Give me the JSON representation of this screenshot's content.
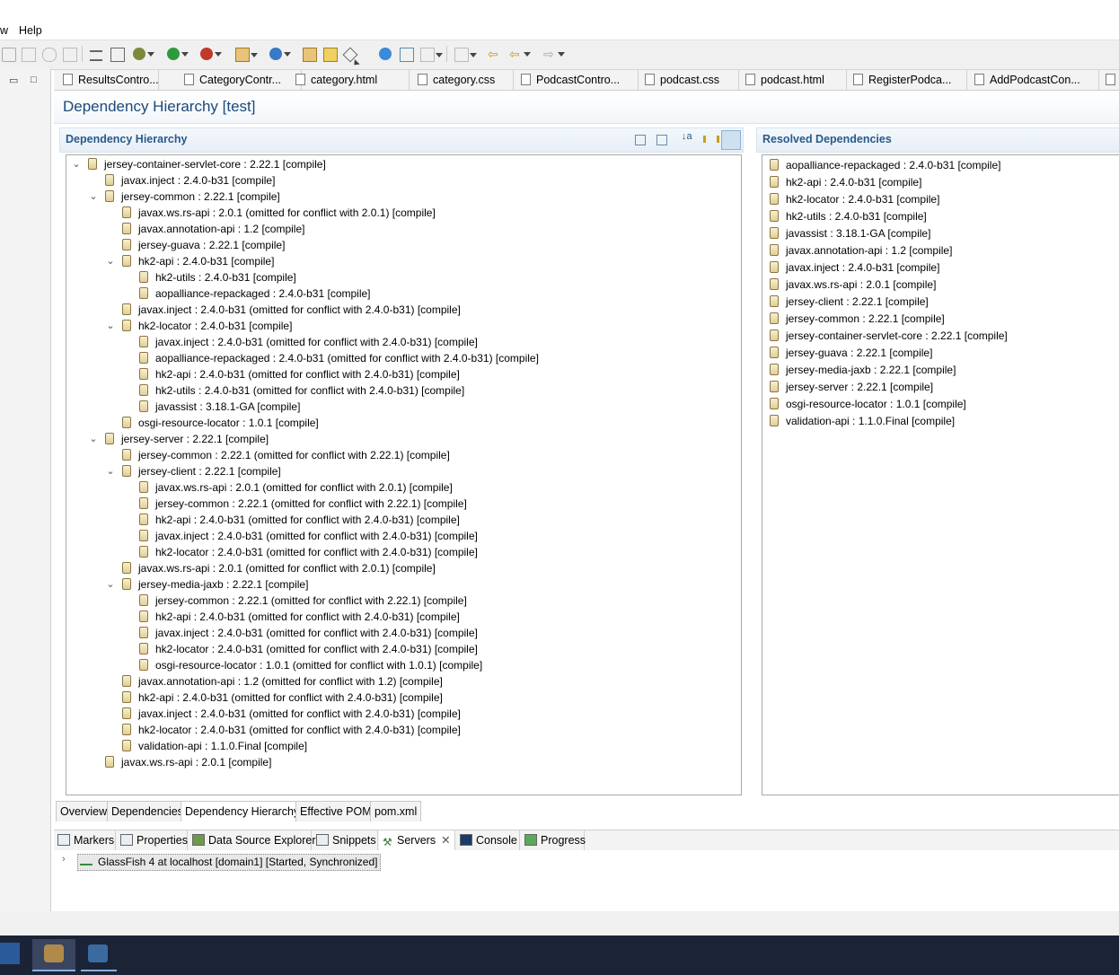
{
  "menu": {
    "partial_item": "w",
    "help": "Help"
  },
  "editor_tabs": [
    "ResultsContro...",
    "CategoryContr...",
    "category.html",
    "category.css",
    "PodcastContro...",
    "podcast.css",
    "podcast.html",
    "RegisterPodca...",
    "AddPodcastCon..."
  ],
  "page_title": "Dependency Hierarchy [test]",
  "hierarchy": {
    "title": "Dependency Hierarchy",
    "rows": [
      {
        "level": 0,
        "toggle": "v",
        "name": "jersey-container-servlet-core",
        "detail": " : 2.22.1 [compile]"
      },
      {
        "level": 1,
        "toggle": "",
        "name": "javax.inject",
        "detail": " : 2.4.0-b31 [compile]"
      },
      {
        "level": 1,
        "toggle": "v",
        "name": "jersey-common",
        "detail": " : 2.22.1 [compile]"
      },
      {
        "level": 2,
        "toggle": "",
        "name": "javax.ws.rs-api",
        "detail": " : 2.0.1 (omitted for conflict with 2.0.1) [compile]"
      },
      {
        "level": 2,
        "toggle": "",
        "name": "javax.annotation-api",
        "detail": " : 1.2 [compile]"
      },
      {
        "level": 2,
        "toggle": "",
        "name": "jersey-guava",
        "detail": " : 2.22.1 [compile]"
      },
      {
        "level": 2,
        "toggle": "v",
        "name": "hk2-api",
        "detail": " : 2.4.0-b31 [compile]"
      },
      {
        "level": 3,
        "toggle": "",
        "name": "hk2-utils",
        "detail": " : 2.4.0-b31 [compile]"
      },
      {
        "level": 3,
        "toggle": "",
        "name": "aopalliance-repackaged",
        "detail": " : 2.4.0-b31 [compile]"
      },
      {
        "level": 2,
        "toggle": "",
        "name": "javax.inject",
        "detail": " : 2.4.0-b31 (omitted for conflict with 2.4.0-b31) [compile]"
      },
      {
        "level": 2,
        "toggle": "v",
        "name": "hk2-locator",
        "detail": " : 2.4.0-b31 [compile]"
      },
      {
        "level": 3,
        "toggle": "",
        "name": "javax.inject",
        "detail": " : 2.4.0-b31 (omitted for conflict with 2.4.0-b31) [compile]"
      },
      {
        "level": 3,
        "toggle": "",
        "name": "aopalliance-repackaged",
        "detail": " : 2.4.0-b31 (omitted for conflict with 2.4.0-b31) [compile]"
      },
      {
        "level": 3,
        "toggle": "",
        "name": "hk2-api",
        "detail": " : 2.4.0-b31 (omitted for conflict with 2.4.0-b31) [compile]"
      },
      {
        "level": 3,
        "toggle": "",
        "name": "hk2-utils",
        "detail": " : 2.4.0-b31 (omitted for conflict with 2.4.0-b31) [compile]"
      },
      {
        "level": 3,
        "toggle": "",
        "name": "javassist",
        "detail": " : 3.18.1-GA [compile]"
      },
      {
        "level": 2,
        "toggle": "",
        "name": "osgi-resource-locator",
        "detail": " : 1.0.1 [compile]"
      },
      {
        "level": 1,
        "toggle": "v",
        "name": "jersey-server",
        "detail": " : 2.22.1 [compile]"
      },
      {
        "level": 2,
        "toggle": "",
        "name": "jersey-common",
        "detail": " : 2.22.1 (omitted for conflict with 2.22.1) [compile]"
      },
      {
        "level": 2,
        "toggle": "v",
        "name": "jersey-client",
        "detail": " : 2.22.1 [compile]"
      },
      {
        "level": 3,
        "toggle": "",
        "name": "javax.ws.rs-api",
        "detail": " : 2.0.1 (omitted for conflict with 2.0.1) [compile]"
      },
      {
        "level": 3,
        "toggle": "",
        "name": "jersey-common",
        "detail": " : 2.22.1 (omitted for conflict with 2.22.1) [compile]"
      },
      {
        "level": 3,
        "toggle": "",
        "name": "hk2-api",
        "detail": " : 2.4.0-b31 (omitted for conflict with 2.4.0-b31) [compile]"
      },
      {
        "level": 3,
        "toggle": "",
        "name": "javax.inject",
        "detail": " : 2.4.0-b31 (omitted for conflict with 2.4.0-b31) [compile]"
      },
      {
        "level": 3,
        "toggle": "",
        "name": "hk2-locator",
        "detail": " : 2.4.0-b31 (omitted for conflict with 2.4.0-b31) [compile]"
      },
      {
        "level": 2,
        "toggle": "",
        "name": "javax.ws.rs-api",
        "detail": " : 2.0.1 (omitted for conflict with 2.0.1) [compile]"
      },
      {
        "level": 2,
        "toggle": "v",
        "name": "jersey-media-jaxb",
        "detail": " : 2.22.1 [compile]"
      },
      {
        "level": 3,
        "toggle": "",
        "name": "jersey-common",
        "detail": " : 2.22.1 (omitted for conflict with 2.22.1) [compile]"
      },
      {
        "level": 3,
        "toggle": "",
        "name": "hk2-api",
        "detail": " : 2.4.0-b31 (omitted for conflict with 2.4.0-b31) [compile]"
      },
      {
        "level": 3,
        "toggle": "",
        "name": "javax.inject",
        "detail": " : 2.4.0-b31 (omitted for conflict with 2.4.0-b31) [compile]"
      },
      {
        "level": 3,
        "toggle": "",
        "name": "hk2-locator",
        "detail": " : 2.4.0-b31 (omitted for conflict with 2.4.0-b31) [compile]"
      },
      {
        "level": 3,
        "toggle": "",
        "name": "osgi-resource-locator",
        "detail": " : 1.0.1 (omitted for conflict with 1.0.1) [compile]"
      },
      {
        "level": 2,
        "toggle": "",
        "name": "javax.annotation-api",
        "detail": " : 1.2 (omitted for conflict with 1.2) [compile]"
      },
      {
        "level": 2,
        "toggle": "",
        "name": "hk2-api",
        "detail": " : 2.4.0-b31 (omitted for conflict with 2.4.0-b31) [compile]"
      },
      {
        "level": 2,
        "toggle": "",
        "name": "javax.inject",
        "detail": " : 2.4.0-b31 (omitted for conflict with 2.4.0-b31) [compile]"
      },
      {
        "level": 2,
        "toggle": "",
        "name": "hk2-locator",
        "detail": " : 2.4.0-b31 (omitted for conflict with 2.4.0-b31) [compile]"
      },
      {
        "level": 2,
        "toggle": "",
        "name": "validation-api",
        "detail": " : 1.1.0.Final [compile]"
      },
      {
        "level": 1,
        "toggle": "",
        "name": "javax.ws.rs-api",
        "detail": " : 2.0.1 [compile]"
      }
    ]
  },
  "resolved": {
    "title": "Resolved Dependencies",
    "items": [
      "aopalliance-repackaged : 2.4.0-b31 [compile]",
      "hk2-api : 2.4.0-b31 [compile]",
      "hk2-locator : 2.4.0-b31 [compile]",
      "hk2-utils : 2.4.0-b31 [compile]",
      "javassist : 3.18.1-GA [compile]",
      "javax.annotation-api : 1.2 [compile]",
      "javax.inject : 2.4.0-b31 [compile]",
      "javax.ws.rs-api : 2.0.1 [compile]",
      "jersey-client : 2.22.1 [compile]",
      "jersey-common : 2.22.1 [compile]",
      "jersey-container-servlet-core : 2.22.1 [compile]",
      "jersey-guava : 2.22.1 [compile]",
      "jersey-media-jaxb : 2.22.1 [compile]",
      "jersey-server : 2.22.1 [compile]",
      "osgi-resource-locator : 1.0.1 [compile]",
      "validation-api : 1.1.0.Final [compile]"
    ]
  },
  "pom_tabs": [
    "Overview",
    "Dependencies",
    "Dependency Hierarchy",
    "Effective POM",
    "pom.xml"
  ],
  "active_pom_tab": "Dependency Hierarchy",
  "view_tabs": [
    "Markers",
    "Properties",
    "Data Source Explorer",
    "Snippets",
    "Servers",
    "Console",
    "Progress"
  ],
  "active_view_tab": "Servers",
  "server": {
    "label": "GlassFish 4 at localhost [domain1]  [Started, Synchronized]"
  },
  "colors": {
    "title": "#1a4a7a",
    "section_title": "#2a5a8a",
    "taskbar": "#1b2336"
  }
}
